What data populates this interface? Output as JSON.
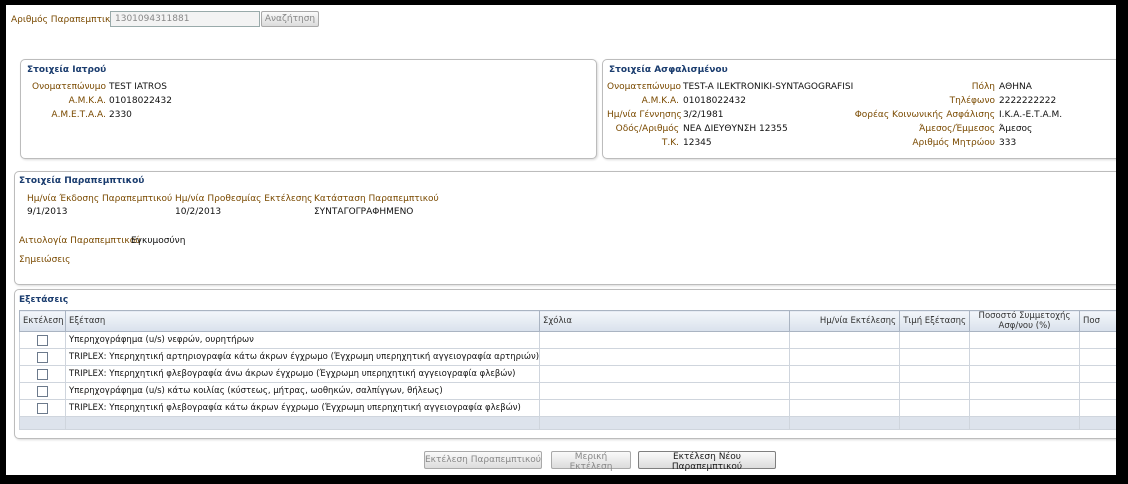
{
  "search": {
    "label": "Αριθμός Παραπεμπτικού",
    "value": "1301094311881",
    "button": "Αναζήτηση"
  },
  "doctor": {
    "title": "Στοιχεία Ιατρού",
    "name_label": "Ονοματεπώνυμο",
    "name": "TEST IATROS",
    "amka_label": "Α.Μ.Κ.Α.",
    "amka": "01018022432",
    "ameta_label": "Α.Μ.Ε.Τ.Α.Α.",
    "ameta": "2330"
  },
  "insured": {
    "title": "Στοιχεία Ασφαλισμένου",
    "name_label": "Ονοματεπώνυμο",
    "name": "TEST-A ILEKTRONIKI-SYNTAGOGRAFISI",
    "amka_label": "Α.Μ.Κ.Α.",
    "amka": "01018022432",
    "birth_label": "Ημ/νία Γέννησης",
    "birth": "3/2/1981",
    "address_label": "Οδός/Αριθμός",
    "address": "ΝΕΑ ΔΙΕΥΘΥΝΣΗ 12355",
    "tk_label": "Τ.Κ.",
    "tk": "12345",
    "city_label": "Πόλη",
    "city": "ΑΘΗΝΑ",
    "phone_label": "Τηλέφωνο",
    "phone": "2222222222",
    "fund_label": "Φορέας Κοινωνικής Ασφάλισης",
    "fund": "Ι.Κ.Α.-Ε.Τ.Α.Μ.",
    "direct_label": "Άμεσος/Έμμεσος",
    "direct": "Άμεσος",
    "reg_label": "Αριθμός Μητρώου",
    "reg": "333"
  },
  "referral": {
    "title": "Στοιχεία Παραπεμπτικού",
    "issue_label": "Ημ/νία Έκδοσης Παραπεμπτικού",
    "issue": "9/1/2013",
    "deadline_label": "Ημ/νία Προθεσμίας Εκτέλεσης",
    "deadline": "10/2/2013",
    "status_label": "Κατάσταση Παραπεμπτικού",
    "status": "ΣΥΝΤΑΓΟΓΡΑΦΗΜΕΝΟ",
    "reason_label": "Αιτιολογία Παραπεμπτικού",
    "reason": "Εγκυμοσύνη",
    "notes_label": "Σημειώσεις"
  },
  "exams": {
    "title": "Εξετάσεις",
    "headers": {
      "exec": "Εκτέλεση",
      "exam": "Εξέταση",
      "comments": "Σχόλια",
      "date": "Ημ/νία Εκτέλεσης",
      "price": "Τιμή Εξέτασης",
      "pct": "Ποσοστό Συμμετοχής Ασφ/νου (%)",
      "more": "Ποσ"
    },
    "rows": [
      "Υπερηχογράφημα (u/s) νεφρών, ουρητήρων",
      "TRIPLEX: Υπερηχητική αρτηριογραφία κάτω άκρων έγχρωμο (Έγχρωμη υπερηχητική αγγειογραφία αρτηριών)",
      "TRIPLEX: Υπερηχητική φλεβογραφία άνω άκρων έγχρωμο (Έγχρωμη υπερηχητική αγγειογραφία φλεβών)",
      "Υπερηχογράφημα (u/s) κάτω κοιλίας (κύστεως, μήτρας, ωοθηκών, σαλπίγγων, θήλεως)",
      "TRIPLEX: Υπερηχητική φλεβογραφία κάτω άκρων έγχρωμο (Έγχρωμη υπερηχητική αγγειογραφία φλεβών)"
    ]
  },
  "actions": {
    "execute": "Εκτέλεση Παραπεμπτικού",
    "partial": "Μερική Εκτέλεση",
    "execute_new": "Εκτέλεση Νέου Παραπεμπτικού"
  }
}
